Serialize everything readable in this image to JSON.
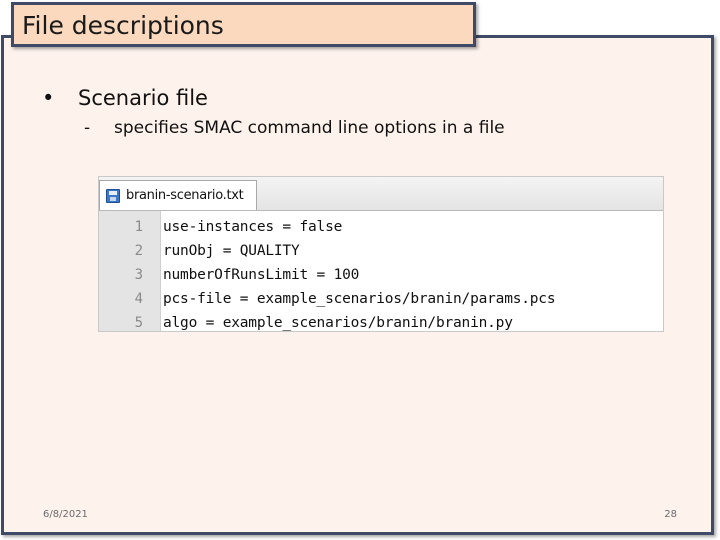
{
  "slide": {
    "title": "File descriptions",
    "bullet": {
      "marker": "•",
      "text": "Scenario file"
    },
    "sub_bullet": {
      "marker": "-",
      "text": "specifies SMAC command line options in a file"
    },
    "footer": {
      "date": "6/8/2021",
      "page_number": "28"
    }
  },
  "editor": {
    "tab_label": "branin-scenario.txt",
    "tab_icon": "floppy-disk-icon",
    "lines": [
      {
        "number": "1",
        "code": "use-instances = false"
      },
      {
        "number": "2",
        "code": "runObj = QUALITY"
      },
      {
        "number": "3",
        "code": "numberOfRunsLimit = 100"
      },
      {
        "number": "4",
        "code": "pcs-file = example_scenarios/branin/params.pcs"
      },
      {
        "number": "5",
        "code": "algo = example_scenarios/branin/branin.py"
      }
    ]
  },
  "colors": {
    "title_fill": "#fad9bf",
    "content_fill": "#fdf3ec",
    "border": "#3e4a66"
  }
}
